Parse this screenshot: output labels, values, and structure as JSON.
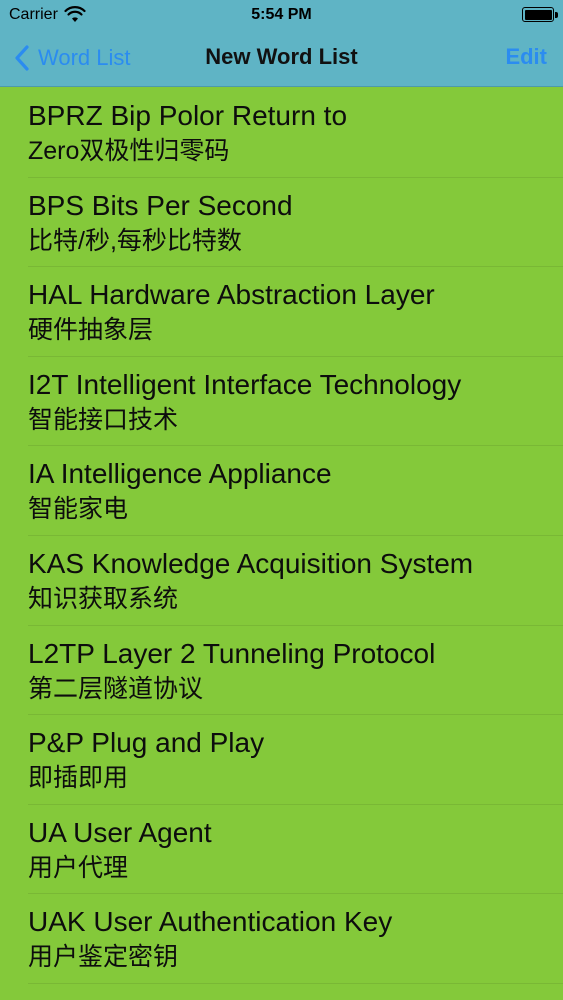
{
  "status_bar": {
    "carrier": "Carrier",
    "time": "5:54 PM",
    "wifi_icon": "wifi-icon",
    "battery_icon": "battery-icon"
  },
  "nav": {
    "back_label": "Word List",
    "title": "New Word List",
    "edit_label": "Edit"
  },
  "colors": {
    "nav_background": "#5fb4c5",
    "list_background": "#84c93a",
    "accent": "#2b8cf0"
  },
  "items": [
    {
      "en": "BPRZ Bip Polor Return to",
      "zh": "Zero双极性归零码"
    },
    {
      "en": "BPS Bits Per Second",
      "zh": "比特/秒,每秒比特数"
    },
    {
      "en": "HAL Hardware Abstraction Layer",
      "zh": "硬件抽象层"
    },
    {
      "en": "I2T Intelligent Interface Technology",
      "zh": "智能接口技术"
    },
    {
      "en": "IA Intelligence Appliance",
      "zh": "智能家电"
    },
    {
      "en": "KAS Knowledge Acquisition System",
      "zh": "知识获取系统"
    },
    {
      "en": "L2TP Layer 2 Tunneling Protocol",
      "zh": "第二层隧道协议"
    },
    {
      "en": "P&P Plug and Play",
      "zh": "即插即用"
    },
    {
      "en": "UA User Agent",
      "zh": "用户代理"
    },
    {
      "en": "UAK User Authentication Key",
      "zh": "用户鉴定密钥"
    }
  ]
}
